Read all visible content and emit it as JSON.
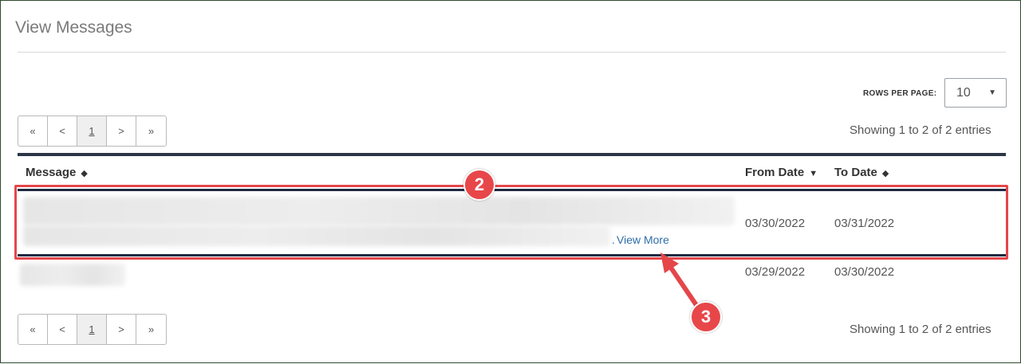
{
  "page": {
    "title": "View Messages"
  },
  "rows_per_page": {
    "label": "ROWS PER PAGE:",
    "value": "10",
    "caret": "▼"
  },
  "pagination": {
    "first": "«",
    "prev": "<",
    "current": "1",
    "next": ">",
    "last": "»"
  },
  "showing": "Showing 1 to 2 of 2 entries",
  "table": {
    "columns": [
      {
        "label": "Message",
        "sort": "◆"
      },
      {
        "label": "From Date",
        "sort": "▼"
      },
      {
        "label": "To Date",
        "sort": "◆"
      }
    ],
    "rows": [
      {
        "from_date": "03/30/2022",
        "to_date": "03/31/2022",
        "link": "View More"
      },
      {
        "from_date": "03/29/2022",
        "to_date": "03/30/2022"
      }
    ]
  },
  "annotations": {
    "badge_a": "2",
    "badge_b": "3",
    "color": "#e5464a"
  }
}
